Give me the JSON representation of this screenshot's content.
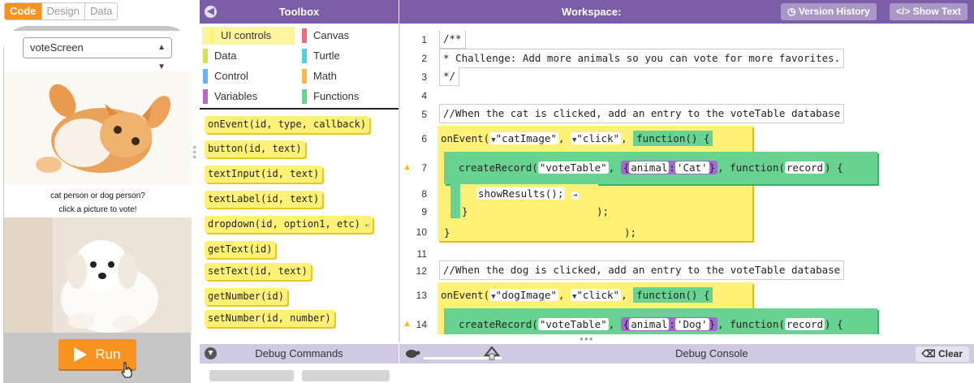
{
  "mode_tabs": [
    "Code",
    "Design",
    "Data"
  ],
  "app_preview": {
    "screen_selector": "voteScreen",
    "prompt_line1": "cat person or dog person?",
    "prompt_line2": "click a picture to vote!",
    "run_label": "Run"
  },
  "toolbox": {
    "title": "Toolbox",
    "categories": [
      {
        "label": "UI controls",
        "color": "#fff176"
      },
      {
        "label": "Canvas",
        "color": "#f06b7c"
      },
      {
        "label": "Data",
        "color": "#d4e157"
      },
      {
        "label": "Turtle",
        "color": "#4dd0e1"
      },
      {
        "label": "Control",
        "color": "#64b5f6"
      },
      {
        "label": "Math",
        "color": "#ffb74d"
      },
      {
        "label": "Variables",
        "color": "#ba68c8"
      },
      {
        "label": "Functions",
        "color": "#68d391"
      }
    ],
    "blocks": [
      "onEvent(id, type, callback)",
      "button(id, text)",
      "textInput(id, text)",
      "textLabel(id, text)",
      "dropdown(id, option1, etc)",
      "getText(id)",
      "setText(id, text)",
      "getNumber(id)",
      "setNumber(id, number)"
    ]
  },
  "workspace": {
    "title": "Workspace:",
    "version_history_label": "Version History",
    "show_text_label": "Show Text",
    "line_numbers": [
      "1",
      "2",
      "3",
      "4",
      "5",
      "6",
      "7",
      "8",
      "9",
      "10",
      "11",
      "12",
      "13",
      "14"
    ],
    "comment_line1": "/**",
    "comment_line2": " * Challenge: Add more animals so you can vote for more favorites.",
    "comment_line3": " */",
    "cat_comment": "//When the cat is clicked, add an entry to the voteTable database",
    "dog_comment": "//When the dog is clicked, add an entry to the voteTable database",
    "onEvent": "onEvent(",
    "cat_id": "\"catImage\"",
    "dog_id": "\"dogImage\"",
    "click": "\"click\"",
    "function_kw": "function()",
    "createRecord": "createRecord(",
    "table": "\"voteTable\"",
    "animal_key": "animal",
    "cat_value": "'Cat'",
    "dog_value": "'Dog'",
    "function_record": "function(",
    "record_param": "record",
    "show_results": "showResults();"
  },
  "debug": {
    "commands_label": "Debug Commands",
    "console_label": "Debug Console",
    "clear_label": "Clear"
  }
}
